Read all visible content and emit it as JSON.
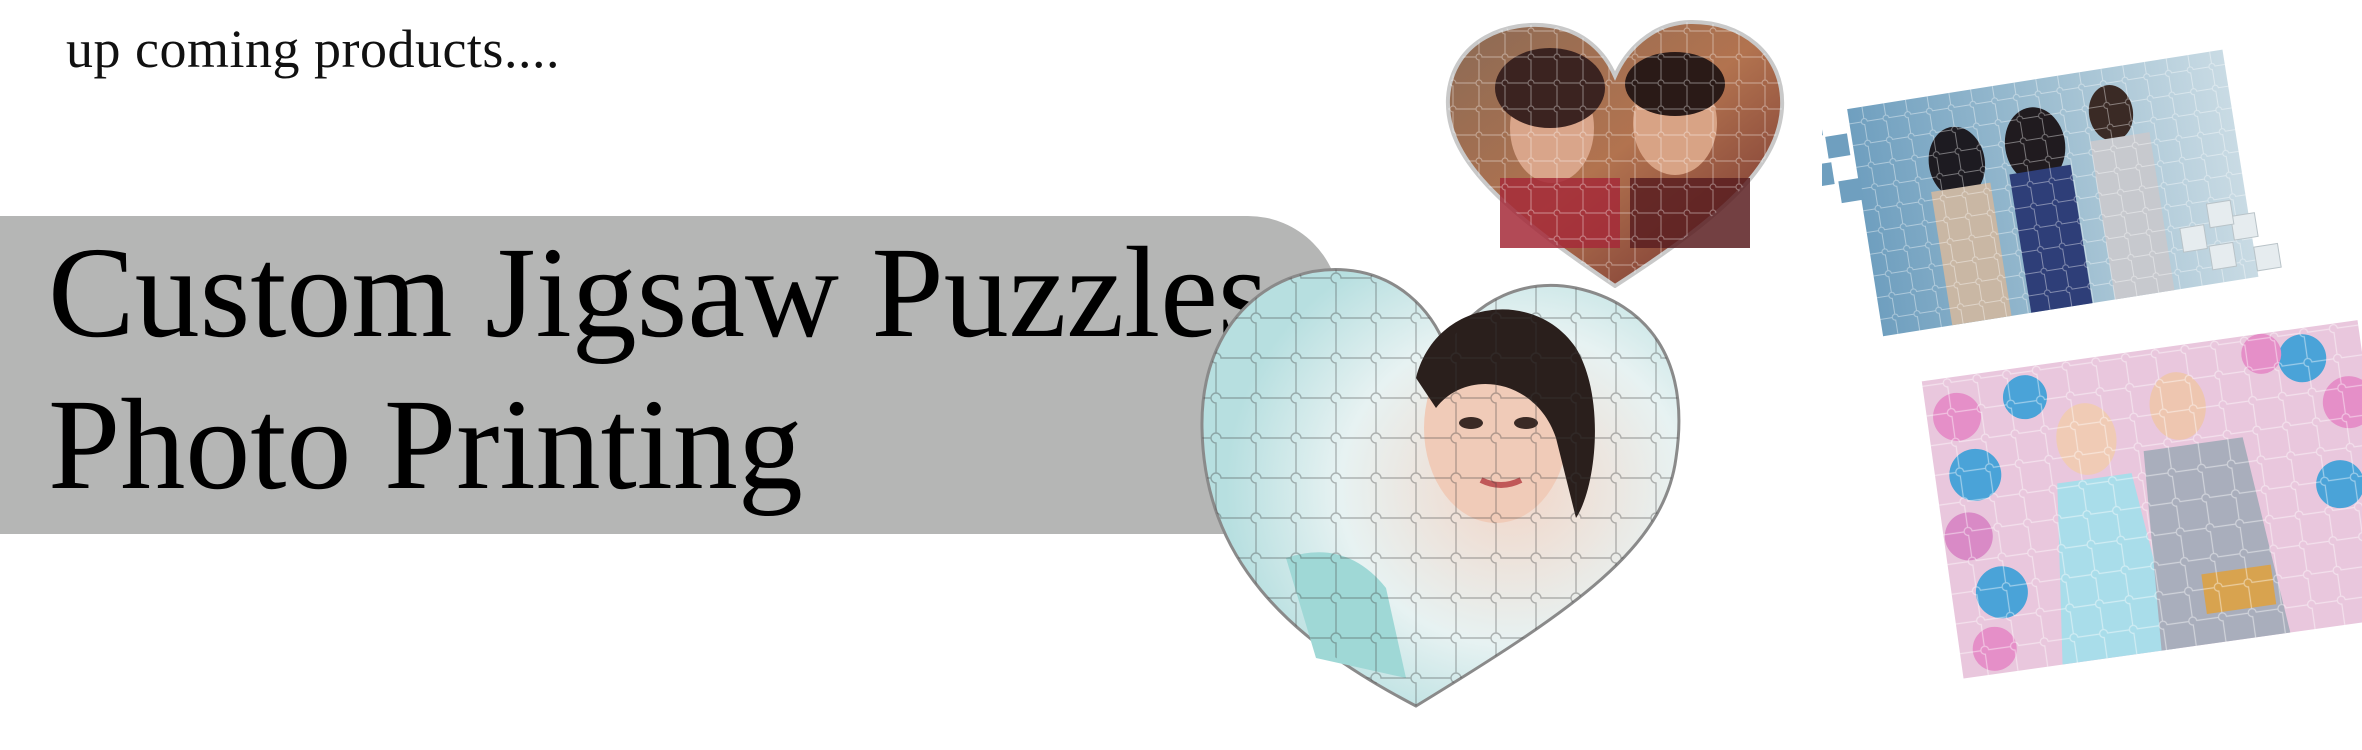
{
  "kicker_text": "up coming products....",
  "headline": {
    "line1": "Custom Jigsaw Puzzles",
    "line2": "Photo Printing"
  },
  "colors": {
    "banner": "#b5b6b5",
    "text": "#000000"
  },
  "products": [
    {
      "name": "heart-puzzle-couple",
      "shape": "heart"
    },
    {
      "name": "rectangle-puzzle-group",
      "shape": "rectangle"
    },
    {
      "name": "heart-puzzle-portrait",
      "shape": "heart"
    },
    {
      "name": "rectangle-puzzle-balloons",
      "shape": "rectangle"
    }
  ]
}
